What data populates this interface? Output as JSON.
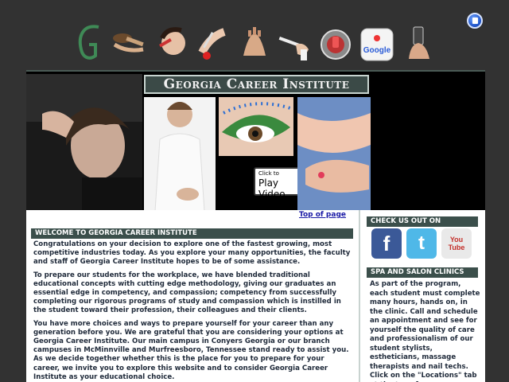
{
  "site": {
    "title": "Georgia Career Institute"
  },
  "icons": [
    "letter-g-logo-icon",
    "makeup-brush-icon",
    "face-makeup-icon",
    "manicure-icon",
    "massage-hands-icon",
    "brush-makeup-icon",
    "lipstick-icon",
    "google-icon",
    "phone-hand-icon"
  ],
  "google_label": "Google",
  "banner": {
    "play_small": "Click to",
    "play_big": "Play Video"
  },
  "nav": {
    "top_link": "Top of page"
  },
  "main": {
    "heading": "WELCOME TO GEORGIA CAREER INSTITUTE",
    "paragraphs": [
      "Congratulations on your decision to explore one of the fastest growing, most competitive industries today. As you explore your many opportunities, the faculty and staff of Georgia Career Institute hopes to be of some assistance.",
      "To prepare our students for the workplace, we have blended traditional educational concepts with cutting edge methodology, giving our graduates an essential edge in competency, and compassion; competency from successfully completing our rigorous programs of study and compassion which is instilled in the student toward their profession, their colleagues and their clients.",
      "You have more choices and ways to prepare yourself for your career than any generation before you. We are grateful that you are considering your options at Georgia Career Institute. Our main campus in Conyers Georgia or our branch campuses in McMinnville and Murfreesboro, Tennessee stand ready to assist you. As we decide together whether this is the place for you to prepare for your career, we invite you to explore this website and to consider Georgia Career Institute as your educational choice."
    ]
  },
  "sidebar": {
    "check_heading": "CHECK US OUT ON",
    "social": [
      {
        "name": "facebook",
        "label": "f",
        "color": "#3b5998"
      },
      {
        "name": "twitter",
        "label": "t",
        "color": "#4fb8e8"
      },
      {
        "name": "youtube",
        "label": "You Tube",
        "color": "#e9e9e9"
      }
    ],
    "spa_heading": "SPA AND SALON CLINICS",
    "spa_text": "As part of the program, each student must complete many hours, hands on, in the clinic. Call and schedule an appointment and see for yourself the quality of care and professionalism of our student stylists, estheticians, massage therapists and nail techs. Click on the \"Locations\" tab at the top of"
  }
}
